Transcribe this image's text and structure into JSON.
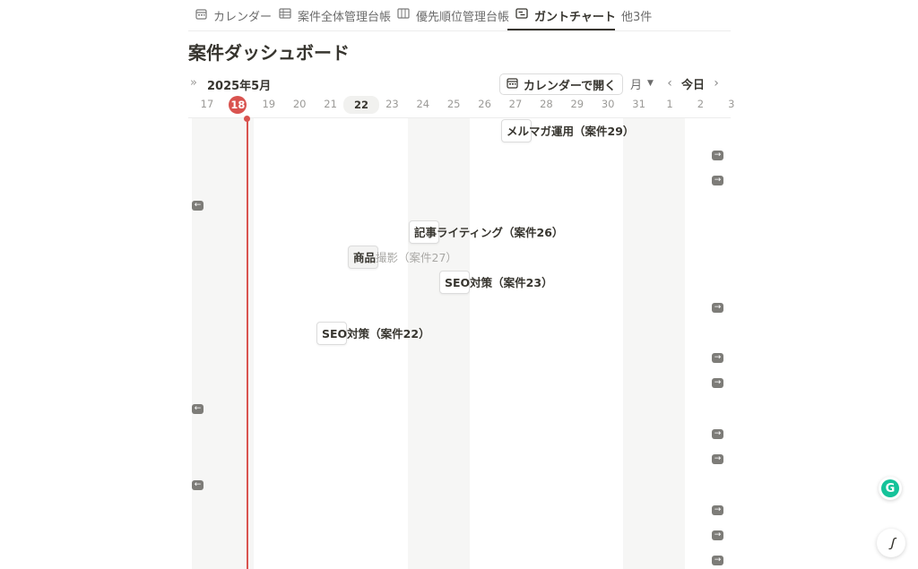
{
  "tabs": [
    {
      "label": "カレンダー",
      "icon": "calendar-icon",
      "active": false
    },
    {
      "label": "案件全体管理台帳",
      "icon": "table-icon",
      "active": false
    },
    {
      "label": "優先順位管理台帳",
      "icon": "board-icon",
      "active": false
    },
    {
      "label": "ガントチャート",
      "icon": "timeline-icon",
      "active": true
    },
    {
      "label": "他3件",
      "icon": "",
      "active": false
    }
  ],
  "page_title": "案件ダッシュボード",
  "toolbar": {
    "month_label": "2025年5月",
    "open_calendar_label": "カレンダーで開く",
    "scale_label": "月",
    "today_label": "今日"
  },
  "dates": [
    "17",
    "18",
    "19",
    "20",
    "21",
    "22",
    "23",
    "24",
    "25",
    "26",
    "27",
    "28",
    "29",
    "30",
    "31",
    "1",
    "2",
    "3"
  ],
  "today_date": "18",
  "hover_date": "22",
  "tasks": [
    {
      "name": "メルマガ運用（案件29）"
    },
    {
      "name": "記事ライティング（案件26）"
    },
    {
      "name": "商品撮影（案件27）"
    },
    {
      "name": "SEO対策（案件23）"
    },
    {
      "name": "SEO対策（案件22）"
    }
  ],
  "colors": {
    "today_marker": "#d9534f",
    "weekend_band": "#f6f6f5",
    "grammarly": "#15c39a"
  }
}
